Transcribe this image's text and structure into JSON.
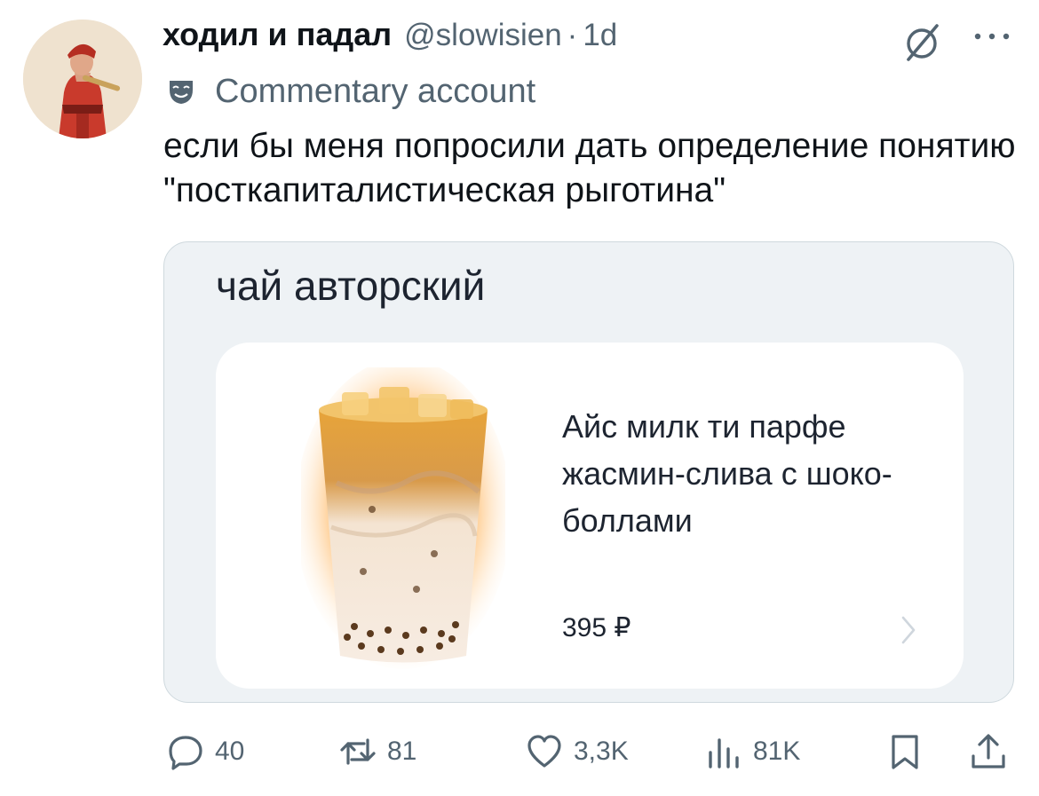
{
  "tweet": {
    "display_name": "ходил и падал",
    "handle": "@slowisien",
    "separator": "·",
    "time": "1d",
    "label": "Commentary account",
    "text": "если бы меня попросили дать определение понятию \"посткапиталистическая рыготина\""
  },
  "media": {
    "title": "чай авторский",
    "product_name": "Айс милк ти парфе жасмин-слива с шоко-боллами",
    "price": "395 ₽"
  },
  "actions": {
    "replies": "40",
    "retweets": "81",
    "likes": "3,3K",
    "views": "81K"
  },
  "icons": [
    "avatar",
    "grok-icon",
    "more-icon",
    "theater-mask-icon",
    "chevron-right-icon",
    "reply-icon",
    "retweet-icon",
    "like-icon",
    "views-icon",
    "bookmark-icon",
    "share-icon"
  ],
  "colors": {
    "text": "#0f1419",
    "secondary": "#536471",
    "card_bg": "#eef2f5",
    "border": "#cfd9de",
    "drink_glow": "#ff9a1e"
  }
}
